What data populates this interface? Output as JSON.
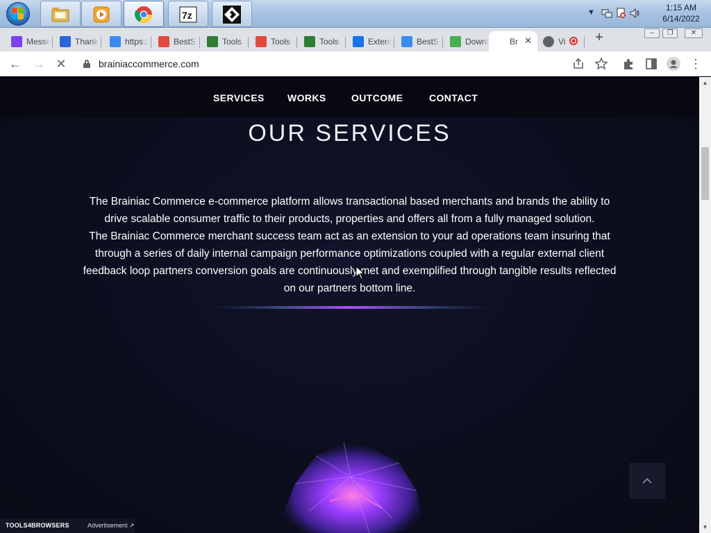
{
  "taskbar": {
    "apps": [
      {
        "name": "windows-explorer",
        "icon": "folder-icon"
      },
      {
        "name": "media-player",
        "icon": "play-icon"
      },
      {
        "name": "google-chrome",
        "icon": "chrome-icon"
      },
      {
        "name": "7-zip",
        "icon": "7z-icon"
      },
      {
        "name": "app",
        "icon": "app-icon"
      }
    ],
    "clock": {
      "time": "1:15 AM",
      "date": "6/14/2022"
    }
  },
  "tabs": [
    {
      "title": "Messenger",
      "favicon": "messenger-icon",
      "color": "#7e3ff2"
    },
    {
      "title": "Thank you",
      "favicon": "malwarebytes-icon",
      "color": "#2b66d9"
    },
    {
      "title": "https://",
      "favicon": "stripe-icon",
      "color": "#3c8af0"
    },
    {
      "title": "BestS",
      "favicon": "rainbow-icon",
      "color": "#e14b3b"
    },
    {
      "title": "Tools",
      "favicon": "tools-icon",
      "color": "#2e7d32"
    },
    {
      "title": "Tools",
      "favicon": "rainbow-icon",
      "color": "#e14b3b"
    },
    {
      "title": "Tools",
      "favicon": "tools-icon",
      "color": "#2e7d32"
    },
    {
      "title": "Extensions",
      "favicon": "puzzle-icon",
      "color": "#1a73e8"
    },
    {
      "title": "BestS",
      "favicon": "stripe-icon",
      "color": "#3c8af0"
    },
    {
      "title": "Download",
      "favicon": "gamepad-icon",
      "color": "#4caf50"
    },
    {
      "title": "Br",
      "favicon": "blank-icon",
      "color": "#ffffff",
      "active": true
    },
    {
      "title": "Vi",
      "favicon": "globe-icon",
      "color": "#5f6368"
    }
  ],
  "toolbar": {
    "url": "brainiaccommerce.com",
    "back_icon": "←",
    "forward_icon": "→",
    "stop_icon": "✕"
  },
  "site": {
    "nav": [
      "SERVICES",
      "WORKS",
      "OUTCOME",
      "CONTACT"
    ],
    "heading": "OUR SERVICES",
    "paragraphs": [
      "The Brainiac Commerce e-commerce platform allows transactional based merchants and brands the ability to drive scalable consumer traffic to their products, properties and offers all from a fully managed solution.",
      "The Brainiac Commerce merchant success team act as an extension to your ad operations team insuring that through a series of daily internal campaign performance optimizations coupled with a regular external client feedback loop partners conversion goals are continuously met and exemplified through tangible results reflected on our partners bottom line."
    ],
    "ad": {
      "brand": "TOOLS4BROWSERS",
      "label": "Advertisement ↗"
    },
    "accent": "#7b3df0"
  }
}
